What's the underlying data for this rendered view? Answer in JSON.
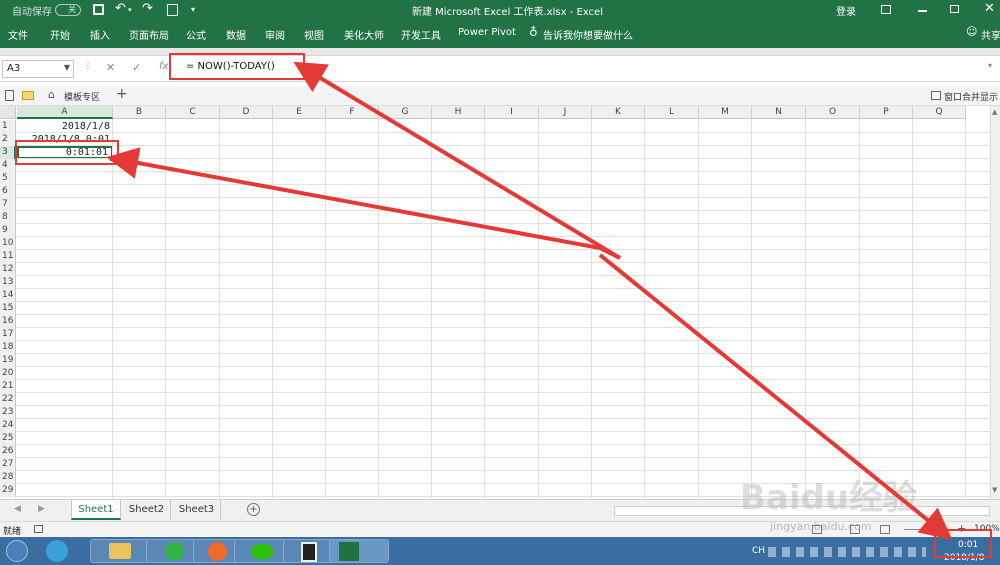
{
  "titlebar": {
    "autosave": "自动保存",
    "autosave_state": "关",
    "title": "新建 Microsoft Excel 工作表.xlsx - Excel",
    "login": "登录"
  },
  "ribbon_tabs": [
    "文件",
    "开始",
    "插入",
    "页面布局",
    "公式",
    "数据",
    "审阅",
    "视图",
    "美化大师",
    "开发工具",
    "Power Pivot"
  ],
  "tellme": "告诉我你想要做什么",
  "share": "共享",
  "formula_bar": {
    "name_box": "A3",
    "fx": "fx",
    "formula": "= NOW()-TODAY()"
  },
  "workbook_tabs": {
    "template": "模板专区",
    "plus": "+",
    "window_merge": "窗口合并显示"
  },
  "grid": {
    "columns": [
      "A",
      "B",
      "C",
      "D",
      "E",
      "F",
      "G",
      "H",
      "I",
      "J",
      "K",
      "L",
      "M",
      "N",
      "O",
      "P",
      "Q"
    ],
    "rows": [
      "1",
      "2",
      "3",
      "4",
      "5",
      "6",
      "7",
      "8",
      "9",
      "10",
      "11",
      "12",
      "13",
      "14",
      "15",
      "16",
      "17",
      "18",
      "19",
      "20",
      "21",
      "22",
      "23",
      "24",
      "25",
      "26",
      "27",
      "28",
      "29"
    ],
    "cells": {
      "A1": "2018/1/8",
      "A2": "2018/1/8 0:01",
      "A3": "0:01:01"
    }
  },
  "sheets": [
    "Sheet1",
    "Sheet2",
    "Sheet3"
  ],
  "active_sheet": "Sheet1",
  "status": {
    "ready": "就绪",
    "zoom": "100%"
  },
  "taskbar": {
    "lang": "CH",
    "time": "0:01",
    "date": "2018/1/8"
  },
  "watermark": {
    "brand": "Baidu经验",
    "url": "jingyan.baidu.com"
  },
  "colors": {
    "excel_green": "#217346",
    "annotation_red": "#e53935",
    "taskbar_blue": "#3a6ea0"
  }
}
